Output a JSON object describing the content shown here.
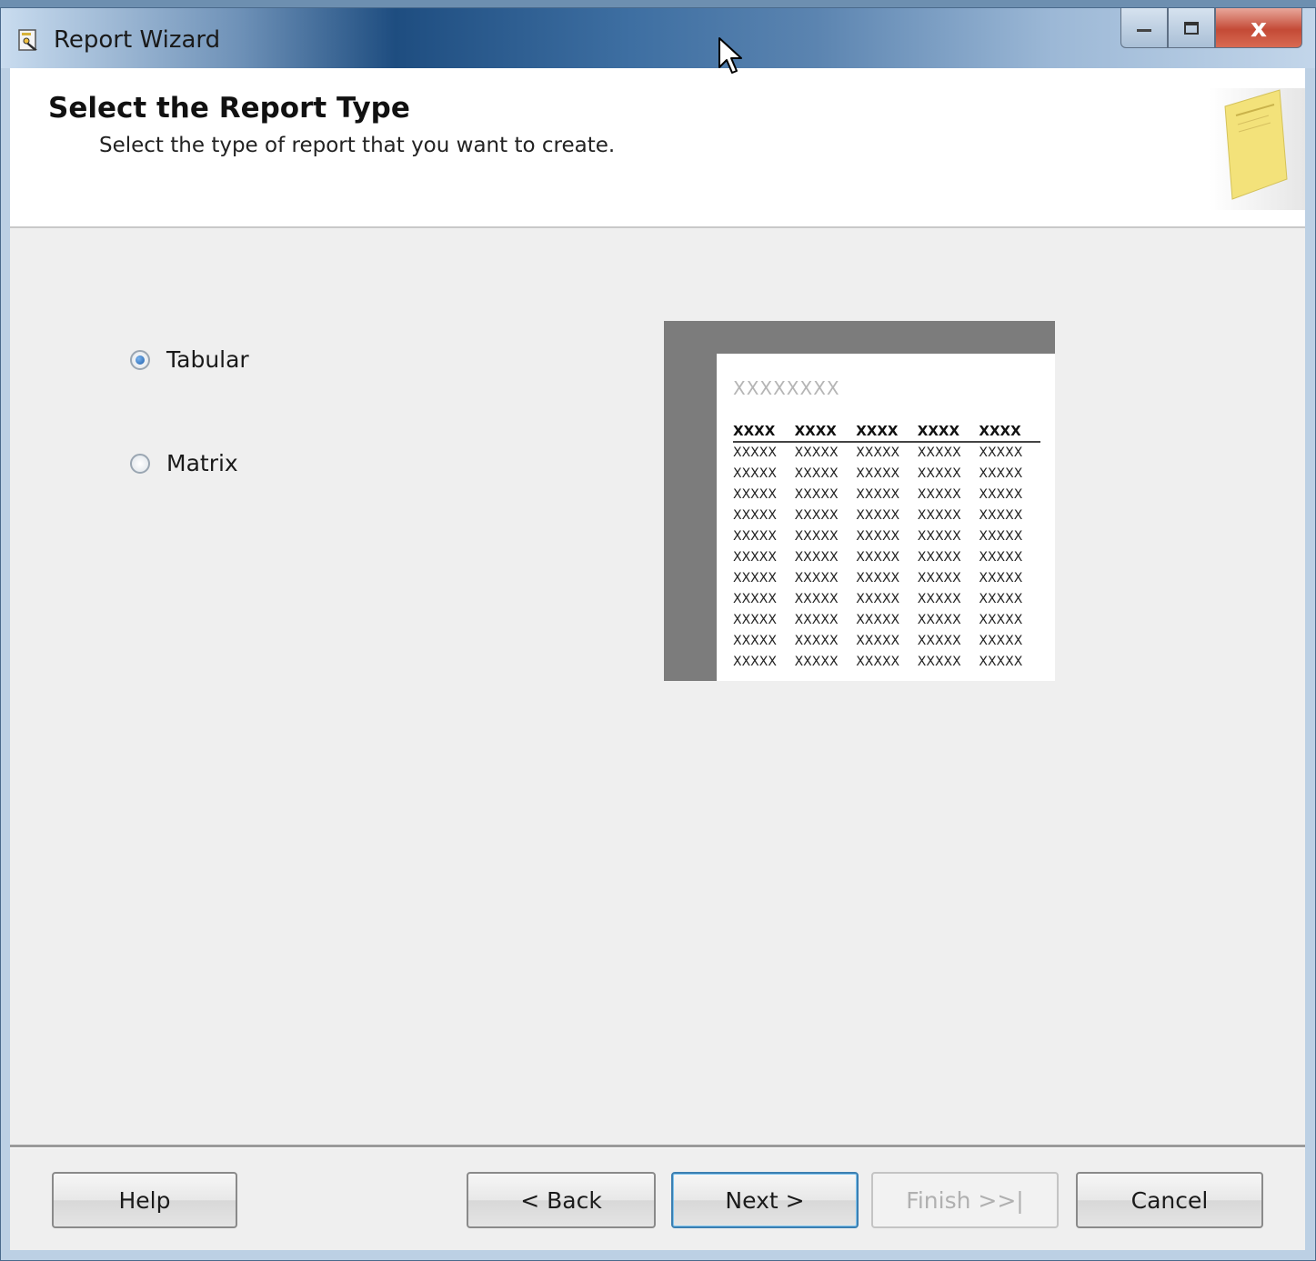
{
  "window": {
    "title": "Report Wizard",
    "close_glyph": "x"
  },
  "header": {
    "title": "Select the Report Type",
    "subtitle": "Select the type of report that you want to create."
  },
  "options": [
    {
      "label": "Tabular",
      "selected": true
    },
    {
      "label": "Matrix",
      "selected": false
    }
  ],
  "preview": {
    "title": "XXXXXXXX",
    "headers": [
      "XXXX",
      "XXXX",
      "XXXX",
      "XXXX",
      "XXXX"
    ],
    "rows": [
      [
        "XXXXX",
        "XXXXX",
        "XXXXX",
        "XXXXX",
        "XXXXX"
      ],
      [
        "XXXXX",
        "XXXXX",
        "XXXXX",
        "XXXXX",
        "XXXXX"
      ],
      [
        "XXXXX",
        "XXXXX",
        "XXXXX",
        "XXXXX",
        "XXXXX"
      ],
      [
        "XXXXX",
        "XXXXX",
        "XXXXX",
        "XXXXX",
        "XXXXX"
      ],
      [
        "XXXXX",
        "XXXXX",
        "XXXXX",
        "XXXXX",
        "XXXXX"
      ],
      [
        "XXXXX",
        "XXXXX",
        "XXXXX",
        "XXXXX",
        "XXXXX"
      ],
      [
        "XXXXX",
        "XXXXX",
        "XXXXX",
        "XXXXX",
        "XXXXX"
      ],
      [
        "XXXXX",
        "XXXXX",
        "XXXXX",
        "XXXXX",
        "XXXXX"
      ],
      [
        "XXXXX",
        "XXXXX",
        "XXXXX",
        "XXXXX",
        "XXXXX"
      ],
      [
        "XXXXX",
        "XXXXX",
        "XXXXX",
        "XXXXX",
        "XXXXX"
      ],
      [
        "XXXXX",
        "XXXXX",
        "XXXXX",
        "XXXXX",
        "XXXXX"
      ]
    ]
  },
  "buttons": {
    "help": "Help",
    "back": "< Back",
    "next": "Next >",
    "finish": "Finish >>|",
    "cancel": "Cancel"
  },
  "colors": {
    "titlebar_dark": "#1e4d80",
    "client_bg": "#efefef",
    "preview_frame": "#7c7c7c",
    "close_button": "#c44a36"
  }
}
